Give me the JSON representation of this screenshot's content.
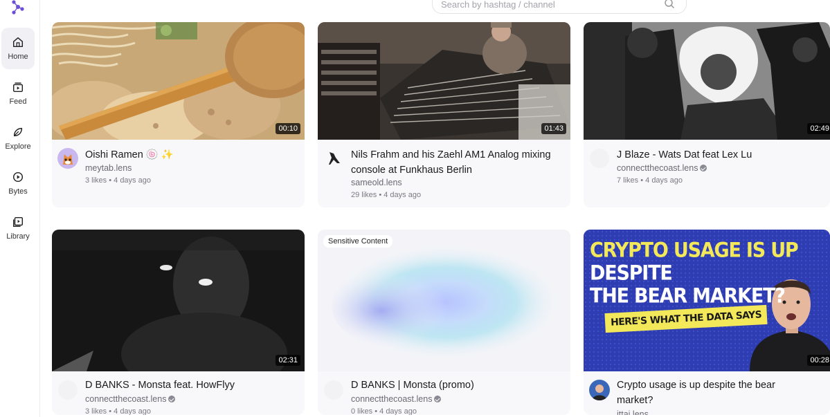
{
  "sidebar": {
    "items": [
      {
        "label": "Home",
        "icon": "home-icon",
        "active": true
      },
      {
        "label": "Feed",
        "icon": "feed-icon",
        "active": false
      },
      {
        "label": "Explore",
        "icon": "explore-icon",
        "active": false
      },
      {
        "label": "Bytes",
        "icon": "bytes-icon",
        "active": false
      },
      {
        "label": "Library",
        "icon": "library-icon",
        "active": false
      }
    ]
  },
  "search": {
    "placeholder": "Search by hashtag / channel"
  },
  "videos": [
    {
      "title": "Oishi Ramen 🍥 ✨",
      "channel": "meytab.lens",
      "verified": false,
      "meta": "3 likes • 4 days ago",
      "duration": "00:10"
    },
    {
      "title": "Nils Frahm and his Zaehl AM1 Analog mixing console at Funkhaus Berlin",
      "channel": "sameold.lens",
      "verified": false,
      "meta": "29 likes • 4 days ago",
      "duration": "01:43"
    },
    {
      "title": "J Blaze - Wats Dat feat Lex Lu",
      "channel": "connectthecoast.lens",
      "verified": true,
      "meta": "7 likes • 4 days ago",
      "duration": "02:49"
    },
    {
      "title": "D BANKS - Monsta feat. HowFlyy",
      "channel": "connectthecoast.lens",
      "verified": true,
      "meta": "3 likes • 4 days ago",
      "duration": "02:31"
    },
    {
      "title": "D BANKS | Monsta (promo)",
      "channel": "connectthecoast.lens",
      "verified": true,
      "meta": "0 likes • 4 days ago",
      "badge": "Sensitive Content"
    },
    {
      "title": "Crypto usage is up despite the bear market?",
      "channel": "ittai.lens",
      "verified": false,
      "duration": "00:28",
      "thumb_text": {
        "line1a": "CRYPTO USAGE IS UP",
        "line1b": "DESPITE",
        "line2": "THE BEAR MARKET?",
        "tag": "HERE'S WHAT THE DATA SAYS"
      }
    }
  ],
  "colors": {
    "brand": "#6c4fd8",
    "crypto_yellow": "#f3e85a",
    "crypto_blue": "#2f3db3"
  }
}
